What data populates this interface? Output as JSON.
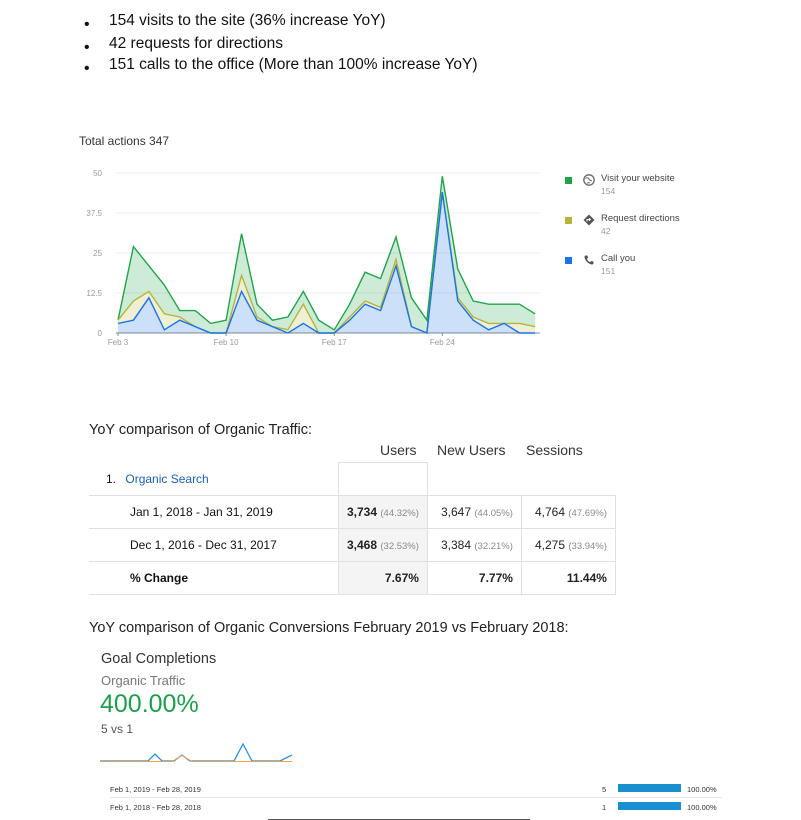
{
  "bullets": [
    "154 visits to the site (36% increase YoY)",
    "42 requests for directions",
    "151 calls to the office (More than 100% increase YoY)"
  ],
  "bullet_glyph": "•",
  "actions_chart": {
    "title": "Total actions 347",
    "legend": [
      {
        "label": "Visit your website",
        "value": "154",
        "color": "#22a34a",
        "icon": "globe-icon"
      },
      {
        "label": "Request directions",
        "value": "42",
        "color": "#b5b53b",
        "icon": "directions-icon"
      },
      {
        "label": "Call you",
        "value": "151",
        "color": "#1a73e8",
        "icon": "phone-icon"
      }
    ]
  },
  "chart_data": {
    "type": "area",
    "title": "Total actions 347",
    "xlabel": "",
    "ylabel": "",
    "ylim": [
      0,
      50
    ],
    "yticks": [
      "0",
      "12.5",
      "25",
      "37.5",
      "50"
    ],
    "x_tick_labels": [
      "Feb 3",
      "Feb 10",
      "Feb 17",
      "Feb 24"
    ],
    "x": [
      "Feb 3",
      "Feb 4",
      "Feb 5",
      "Feb 6",
      "Feb 7",
      "Feb 8",
      "Feb 9",
      "Feb 10",
      "Feb 11",
      "Feb 12",
      "Feb 13",
      "Feb 14",
      "Feb 15",
      "Feb 16",
      "Feb 17",
      "Feb 18",
      "Feb 19",
      "Feb 20",
      "Feb 21",
      "Feb 22",
      "Feb 23",
      "Feb 24",
      "Feb 25",
      "Feb 26",
      "Feb 27",
      "Feb 28",
      "Mar 1",
      "Mar 2"
    ],
    "stacked": true,
    "legend_position": "right",
    "grid": true,
    "series": [
      {
        "name": "Call you",
        "color": "#1a73e8",
        "values": [
          3,
          4,
          11,
          1,
          4,
          2,
          0,
          0,
          13,
          4,
          2,
          0,
          3,
          0,
          0,
          4,
          9,
          7,
          21,
          2,
          0,
          44,
          10,
          4,
          1,
          3,
          0,
          0
        ]
      },
      {
        "name": "Request directions",
        "color": "#b5b53b",
        "values": [
          1,
          6,
          2,
          5,
          1,
          0,
          0,
          0,
          5,
          1,
          0,
          1,
          6,
          0,
          0,
          1,
          1,
          1,
          2,
          0,
          0,
          0,
          1,
          1,
          2,
          0,
          3,
          2
        ]
      },
      {
        "name": "Visit your website",
        "color": "#22a34a",
        "values": [
          0,
          17,
          8,
          9,
          2,
          5,
          3,
          4,
          13,
          4,
          2,
          4,
          4,
          4,
          1,
          4,
          9,
          9,
          7,
          9,
          4,
          5,
          9,
          5,
          6,
          6,
          6,
          4
        ]
      }
    ]
  },
  "organic_traffic": {
    "heading": "YoY comparison of Organic Traffic:",
    "columns": [
      "Users",
      "New Users",
      "Sessions"
    ],
    "source": {
      "index": "1.",
      "name": "Organic Search"
    },
    "rows": [
      {
        "period": "Jan 1, 2018 - Jan 31, 2019",
        "users": "3,734",
        "users_pct": "(44.32%)",
        "new_users": "3,647",
        "new_users_pct": "(44.05%)",
        "sessions": "4,764",
        "sessions_pct": "(47.69%)"
      },
      {
        "period": "Dec 1, 2016 - Dec 31, 2017",
        "users": "3,468",
        "users_pct": "(32.53%)",
        "new_users": "3,384",
        "new_users_pct": "(32.21%)",
        "sessions": "4,275",
        "sessions_pct": "(33.94%)"
      }
    ],
    "change": {
      "label": "% Change",
      "users": "7.67%",
      "new_users": "7.77%",
      "sessions": "11.44%"
    }
  },
  "organic_conversions": {
    "heading": "YoY comparison of Organic Conversions February 2019 vs February 2018:",
    "metric": "Goal Completions",
    "segment": "Organic Traffic",
    "change": "400.00%",
    "comparison": "5 vs 1",
    "rows": [
      {
        "period": "Feb 1, 2019 - Feb 28, 2019",
        "value": "5",
        "percent": "100.00%",
        "fill": 1.0
      },
      {
        "period": "Feb 1, 2018 - Feb 28, 2018",
        "value": "1",
        "percent": "100.00%",
        "fill": 1.0
      }
    ]
  }
}
